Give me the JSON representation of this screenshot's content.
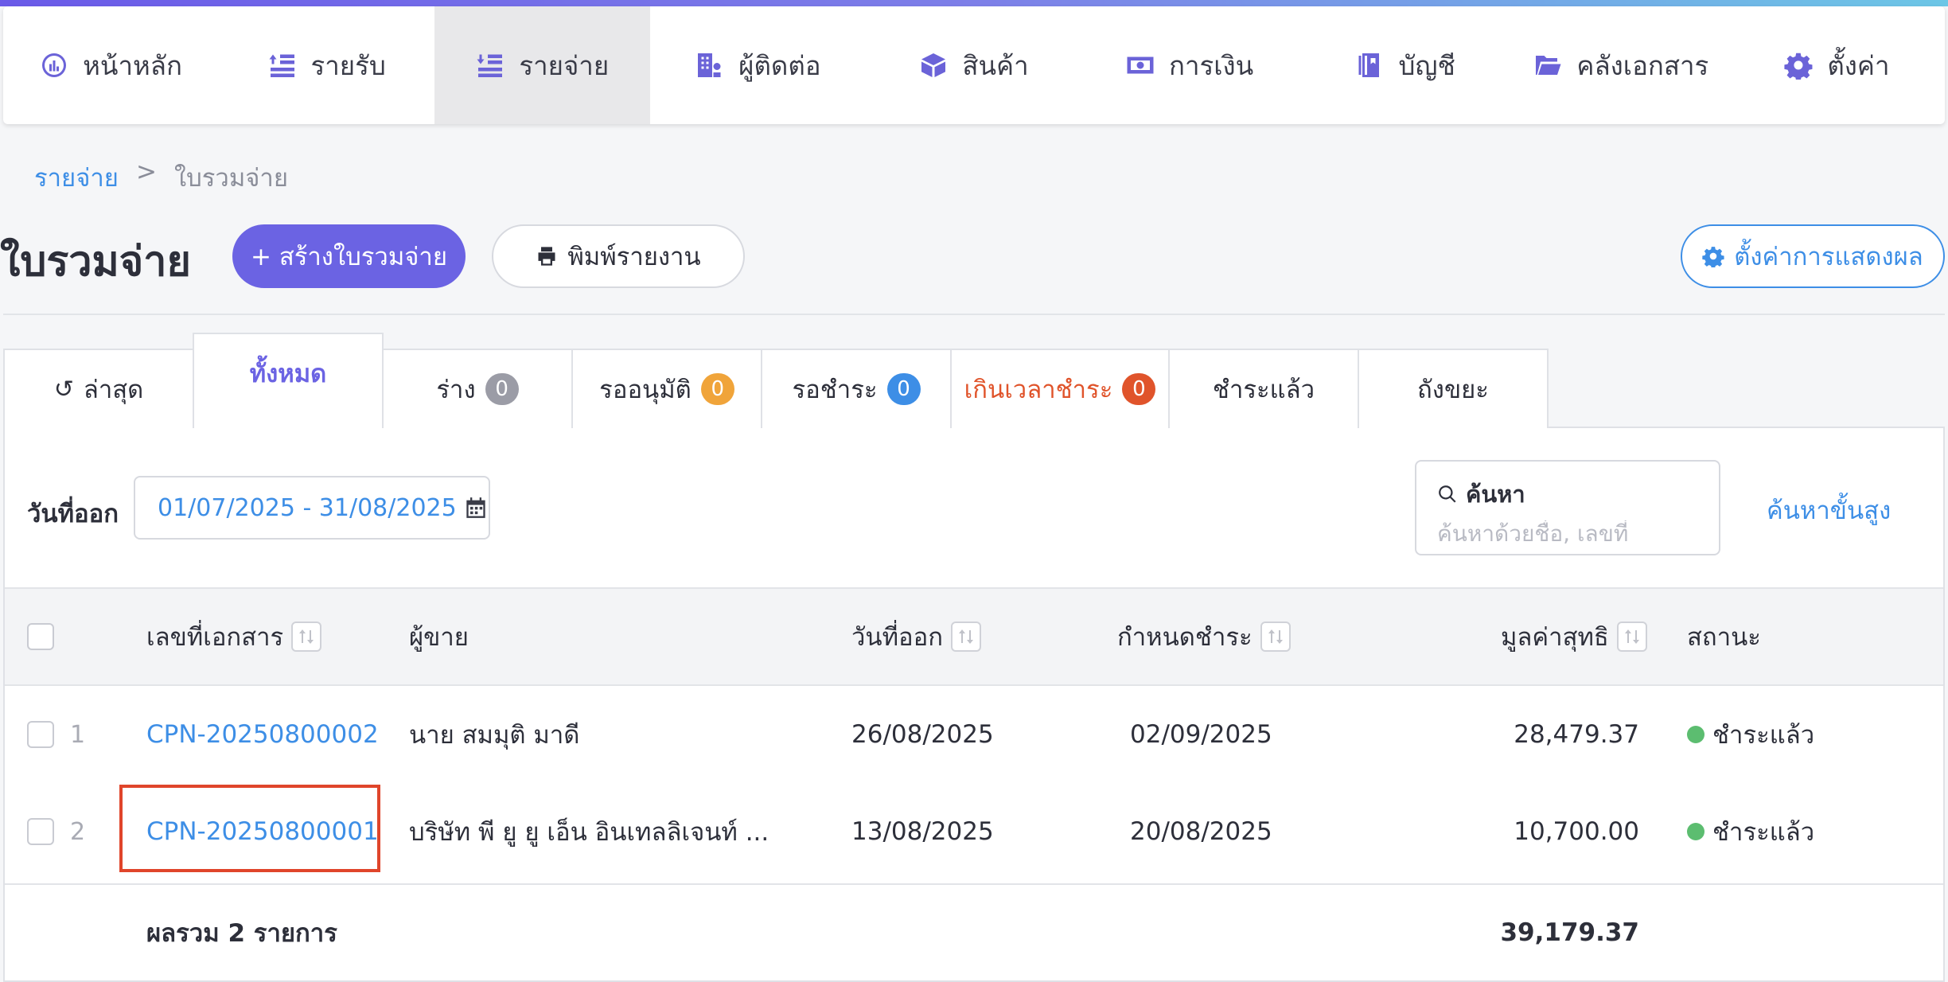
{
  "nav": {
    "items": [
      {
        "label": "หน้าหลัก",
        "icon": "dashboard-icon"
      },
      {
        "label": "รายรับ",
        "icon": "income-icon"
      },
      {
        "label": "รายจ่าย",
        "icon": "expense-icon",
        "active": true
      },
      {
        "label": "ผู้ติดต่อ",
        "icon": "contacts-icon"
      },
      {
        "label": "สินค้า",
        "icon": "box-icon"
      },
      {
        "label": "การเงิน",
        "icon": "money-icon"
      },
      {
        "label": "บัญชี",
        "icon": "ledger-icon"
      },
      {
        "label": "คลังเอกสาร",
        "icon": "folder-icon"
      },
      {
        "label": "ตั้งค่า",
        "icon": "gear-icon"
      }
    ]
  },
  "breadcrumb": {
    "parent": "รายจ่าย",
    "separator": ">",
    "current": "ใบรวมจ่าย"
  },
  "header": {
    "title": "ใบรวมจ่าย",
    "create_label": "+ สร้างใบรวมจ่าย",
    "print_label": "พิมพ์รายงาน",
    "settings_label": "ตั้งค่าการแสดงผล"
  },
  "tabs": [
    {
      "label": "ล่าสุด",
      "icon": "history-icon"
    },
    {
      "label": "ทั้งหมด",
      "active": true
    },
    {
      "label": "ร่าง",
      "badge": "0",
      "badge_color": "#9b9ca6"
    },
    {
      "label": "รออนุมัติ",
      "badge": "0",
      "badge_color": "#f0a43a"
    },
    {
      "label": "รอชำระ",
      "badge": "0",
      "badge_color": "#3d8ee6"
    },
    {
      "label": "เกินเวลาชำระ",
      "badge": "0",
      "badge_color": "#e0542b"
    },
    {
      "label": "ชำระแล้ว"
    },
    {
      "label": "ถังขยะ"
    }
  ],
  "filters": {
    "date_label": "วันที่ออก",
    "date_range": "01/07/2025 - 31/08/2025",
    "search_label": "ค้นหา",
    "search_placeholder": "ค้นหาด้วยชื่อ, เลขที่",
    "advanced_search": "ค้นหาขั้นสูง"
  },
  "table": {
    "columns": {
      "doc_no": "เลขที่เอกสาร",
      "vendor": "ผู้ขาย",
      "issue_date": "วันที่ออก",
      "due_date": "กำหนดชำระ",
      "net_value": "มูลค่าสุทธิ",
      "status": "สถานะ"
    },
    "rows": [
      {
        "num": "1",
        "doc_no": "CPN-20250800002",
        "vendor": "นาย สมมุติ มาดี",
        "issue_date": "26/08/2025",
        "due_date": "02/09/2025",
        "net_value": "28,479.37",
        "status": "ชำระแล้ว"
      },
      {
        "num": "2",
        "doc_no": "CPN-20250800001",
        "vendor": "บริษัท พี ยู ยู เอ็น อินเทลลิเจนท์ ...",
        "issue_date": "13/08/2025",
        "due_date": "20/08/2025",
        "net_value": "10,700.00",
        "status": "ชำระแล้ว"
      }
    ],
    "total_label": "ผลรวม 2 รายการ",
    "total_value": "39,179.37"
  }
}
